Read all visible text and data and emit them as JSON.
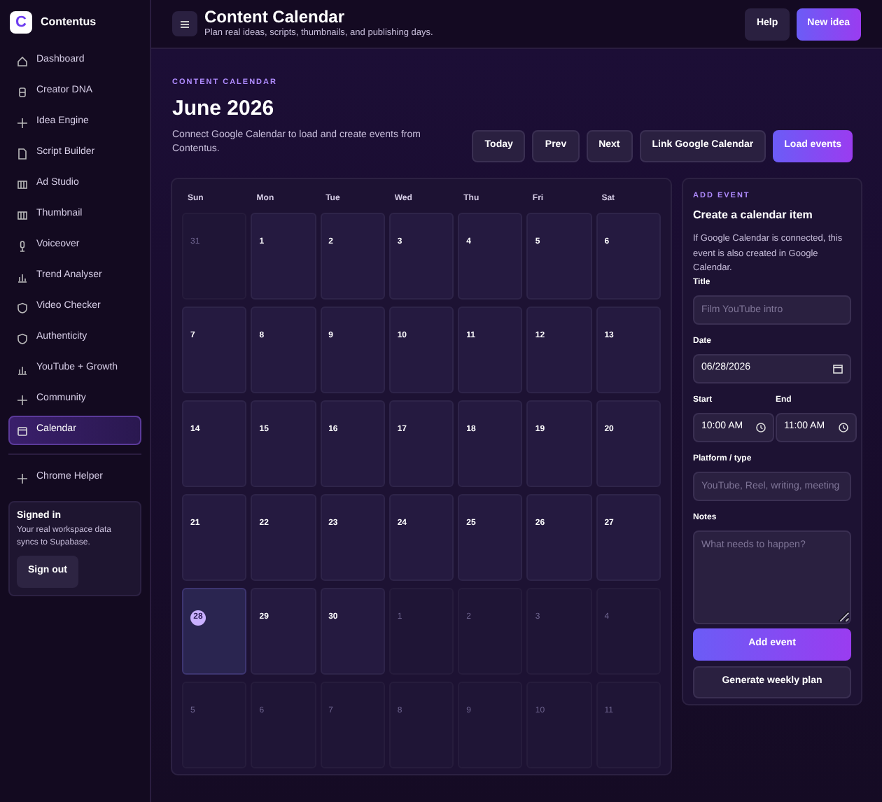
{
  "brand": {
    "name": "Contentus",
    "logo": "C"
  },
  "sidebar": {
    "items": [
      {
        "label": "Dashboard",
        "selected": false
      },
      {
        "label": "Creator DNA",
        "selected": false
      },
      {
        "label": "Idea Engine",
        "selected": false
      },
      {
        "label": "Script Builder",
        "selected": false
      },
      {
        "label": "Ad Studio",
        "selected": false
      },
      {
        "label": "Thumbnail",
        "selected": false
      },
      {
        "label": "Voiceover",
        "selected": false
      },
      {
        "label": "Trend Analyser",
        "selected": false
      },
      {
        "label": "Video Checker",
        "selected": false
      },
      {
        "label": "Authenticity",
        "selected": false
      },
      {
        "label": "YouTube + Growth",
        "selected": false
      },
      {
        "label": "Community",
        "selected": false
      },
      {
        "label": "Calendar",
        "selected": true
      }
    ],
    "extra_items": [
      {
        "label": "Chrome Helper",
        "selected": false
      }
    ],
    "account": {
      "title": "Signed in",
      "text": "Your real workspace data syncs to Supabase.",
      "button": "Sign out"
    }
  },
  "header": {
    "title": "Content Calendar",
    "subtitle": "Plan real ideas, scripts, thumbnails, and publishing days.",
    "buttons": [
      "Help",
      "New idea"
    ]
  },
  "hero": {
    "eyebrow": "CONTENT CALENDAR",
    "title": "June 2026",
    "text": "Connect Google Calendar to load and create events from Contentus.",
    "buttons": [
      {
        "label": "Today",
        "primary": false
      },
      {
        "label": "Prev",
        "primary": false
      },
      {
        "label": "Next",
        "primary": false
      },
      {
        "label": "Link Google Calendar",
        "primary": false
      },
      {
        "label": "Load events",
        "primary": true
      }
    ]
  },
  "calendar": {
    "weekdays": [
      "Sun",
      "Mon",
      "Tue",
      "Wed",
      "Thu",
      "Fri",
      "Sat"
    ],
    "days": [
      {
        "day": "31",
        "in_month": false,
        "selected": false
      },
      {
        "day": "1",
        "in_month": true,
        "selected": false
      },
      {
        "day": "2",
        "in_month": true,
        "selected": false
      },
      {
        "day": "3",
        "in_month": true,
        "selected": false
      },
      {
        "day": "4",
        "in_month": true,
        "selected": false
      },
      {
        "day": "5",
        "in_month": true,
        "selected": false
      },
      {
        "day": "6",
        "in_month": true,
        "selected": false
      },
      {
        "day": "7",
        "in_month": true,
        "selected": false
      },
      {
        "day": "8",
        "in_month": true,
        "selected": false
      },
      {
        "day": "9",
        "in_month": true,
        "selected": false
      },
      {
        "day": "10",
        "in_month": true,
        "selected": false
      },
      {
        "day": "11",
        "in_month": true,
        "selected": false
      },
      {
        "day": "12",
        "in_month": true,
        "selected": false
      },
      {
        "day": "13",
        "in_month": true,
        "selected": false
      },
      {
        "day": "14",
        "in_month": true,
        "selected": false
      },
      {
        "day": "15",
        "in_month": true,
        "selected": false
      },
      {
        "day": "16",
        "in_month": true,
        "selected": false
      },
      {
        "day": "17",
        "in_month": true,
        "selected": false
      },
      {
        "day": "18",
        "in_month": true,
        "selected": false
      },
      {
        "day": "19",
        "in_month": true,
        "selected": false
      },
      {
        "day": "20",
        "in_month": true,
        "selected": false
      },
      {
        "day": "21",
        "in_month": true,
        "selected": false
      },
      {
        "day": "22",
        "in_month": true,
        "selected": false
      },
      {
        "day": "23",
        "in_month": true,
        "selected": false
      },
      {
        "day": "24",
        "in_month": true,
        "selected": false
      },
      {
        "day": "25",
        "in_month": true,
        "selected": false
      },
      {
        "day": "26",
        "in_month": true,
        "selected": false
      },
      {
        "day": "27",
        "in_month": true,
        "selected": false
      },
      {
        "day": "28",
        "in_month": true,
        "selected": true
      },
      {
        "day": "29",
        "in_month": true,
        "selected": false
      },
      {
        "day": "30",
        "in_month": true,
        "selected": false
      },
      {
        "day": "1",
        "in_month": false,
        "selected": false
      },
      {
        "day": "2",
        "in_month": false,
        "selected": false
      },
      {
        "day": "3",
        "in_month": false,
        "selected": false
      },
      {
        "day": "4",
        "in_month": false,
        "selected": false
      },
      {
        "day": "5",
        "in_month": false,
        "selected": false
      },
      {
        "day": "6",
        "in_month": false,
        "selected": false
      },
      {
        "day": "7",
        "in_month": false,
        "selected": false
      },
      {
        "day": "8",
        "in_month": false,
        "selected": false
      },
      {
        "day": "9",
        "in_month": false,
        "selected": false
      },
      {
        "day": "10",
        "in_month": false,
        "selected": false
      },
      {
        "day": "11",
        "in_month": false,
        "selected": false
      }
    ]
  },
  "add_event": {
    "eyebrow": "ADD EVENT",
    "title": "Create a calendar item",
    "text": "If Google Calendar is connected, this event is also created in Google Calendar.",
    "title_field": {
      "label": "Title",
      "placeholder": "Film YouTube intro"
    },
    "date_field": {
      "label": "Date",
      "value": "06/28/2026"
    },
    "start_field": {
      "label": "Start",
      "value": "10:00 AM"
    },
    "end_field": {
      "label": "End",
      "value": "11:00 AM"
    },
    "platform_field": {
      "label": "Platform / type",
      "placeholder": "YouTube, Reel, writing, meeting"
    },
    "notes_field": {
      "label": "Notes",
      "placeholder": "What needs to happen?"
    },
    "primary_button": "Add event",
    "secondary_button": "Generate weekly plan"
  }
}
